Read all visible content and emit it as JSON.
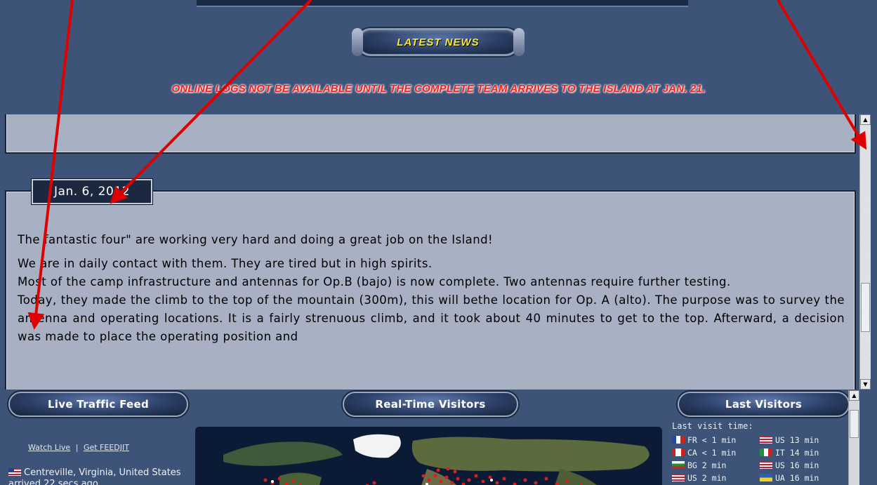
{
  "header": {
    "news_title": "LATEST NEWS",
    "alert_text": "ONLINE LOGS NOT BE AVAILABLE UNTIL THE COMPLETE TEAM ARRIVES TO THE ISLAND AT JAN. 21."
  },
  "post": {
    "date": "Jan. 6, 2012",
    "paragraphs": [
      "The fantastic four\" are working very hard and doing a great job on the Island!",
      "We are in daily contact with them. They are tired but in high spirits.",
      "Most of the camp infrastructure and antennas for Op.B (bajo) is now complete. Two antennas require further testing.",
      "Today, they made the climb to the top of the mountain (300m), this will bethe location for Op. A (alto). The purpose was to survey the antenna and operating locations. It is a fairly strenuous climb, and it took about 40 minutes to get to the top. Afterward, a decision was made to place the operating position and"
    ]
  },
  "widgets": {
    "live_traffic": {
      "title": "Live Traffic Feed",
      "watch_live": "Watch Live",
      "separator": "|",
      "get_feedjit": "Get FEEDJIT",
      "item_text": "Centreville, Virginia, United States arrived 22 secs ago"
    },
    "realtime": {
      "title": "Real-Time Visitors"
    },
    "last_visitors": {
      "title": "Last Visitors",
      "subtitle": "Last visit time:",
      "rows": [
        [
          {
            "cc": "FR",
            "time": "< 1 min"
          },
          {
            "cc": "US",
            "time": "13 min"
          }
        ],
        [
          {
            "cc": "CA",
            "time": "< 1 min"
          },
          {
            "cc": "IT",
            "time": "14 min"
          }
        ],
        [
          {
            "cc": "BG",
            "time": "2 min"
          },
          {
            "cc": "US",
            "time": "16 min"
          }
        ],
        [
          {
            "cc": "US",
            "time": "2 min"
          },
          {
            "cc": "UA",
            "time": "16 min"
          }
        ]
      ]
    }
  },
  "colors": {
    "page_bg": "#3e5378",
    "panel_bg": "#a8b1c4",
    "alert_red": "#ff1a1a",
    "news_yellow": "#f5ea3a",
    "annotation_arrow": "#e00000"
  }
}
